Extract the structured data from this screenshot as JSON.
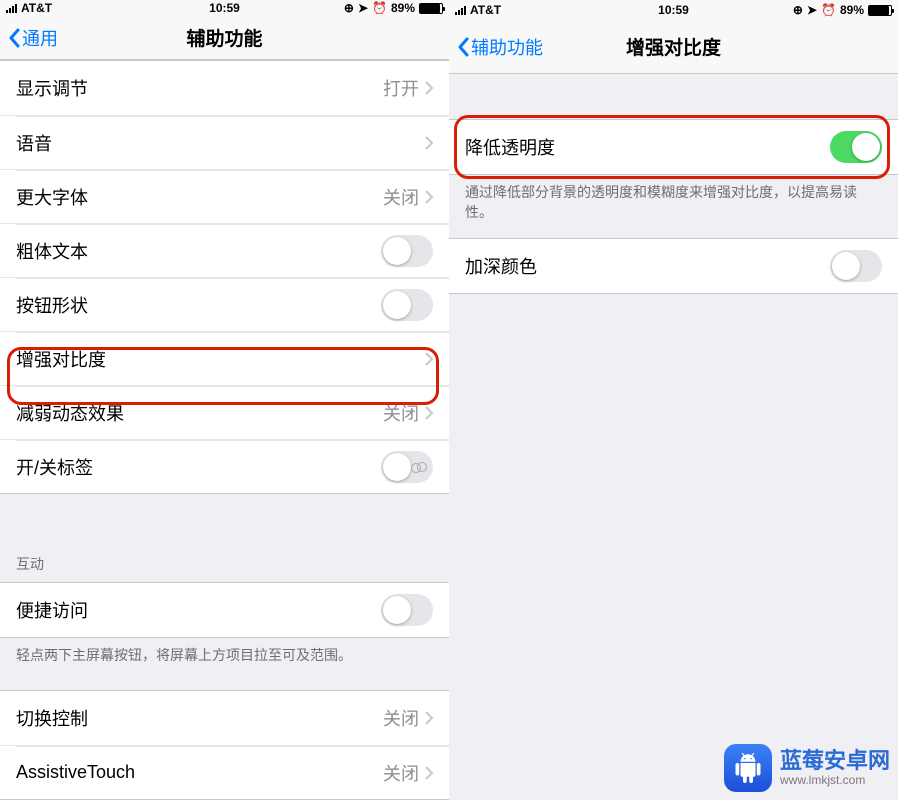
{
  "status": {
    "carrier": "AT&T",
    "time": "10:59",
    "battery_pct": "89%"
  },
  "left": {
    "back": "通用",
    "title": "辅助功能",
    "rows": {
      "display": {
        "label": "显示调节",
        "value": "打开"
      },
      "voice": {
        "label": "语音"
      },
      "larger": {
        "label": "更大字体",
        "value": "关闭"
      },
      "bold": {
        "label": "粗体文本"
      },
      "shapes": {
        "label": "按钮形状"
      },
      "contrast": {
        "label": "增强对比度"
      },
      "reduce_motion": {
        "label": "减弱动态效果",
        "value": "关闭"
      },
      "on_off_labels": {
        "label": "开/关标签"
      }
    },
    "section_interaction": "互动",
    "reachability": {
      "label": "便捷访问"
    },
    "reachability_footer": "轻点两下主屏幕按钮，将屏幕上方项目拉至可及范围。",
    "switch_control": {
      "label": "切换控制",
      "value": "关闭"
    },
    "assistive": {
      "label": "AssistiveTouch",
      "value": "关闭"
    }
  },
  "right": {
    "back": "辅助功能",
    "title": "增强对比度",
    "reduce_transparency": {
      "label": "降低透明度"
    },
    "reduce_transparency_footer": "通过降低部分背景的透明度和模糊度来增强对比度，以提高易读性。",
    "darken_colors": {
      "label": "加深颜色"
    }
  },
  "watermark": {
    "title": "蓝莓安卓网",
    "sub": "www.lmkjst.com"
  }
}
